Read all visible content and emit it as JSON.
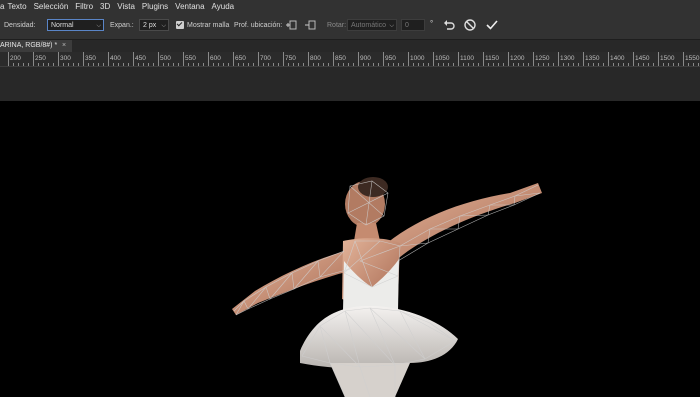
{
  "menu": {
    "items": [
      "a",
      "Texto",
      "Selección",
      "Filtro",
      "3D",
      "Vista",
      "Plugins",
      "Ventana",
      "Ayuda"
    ]
  },
  "options": {
    "density_label": "Densidad:",
    "density_value": "Normal",
    "expansion_label": "Expan.:",
    "expansion_value": "2 px",
    "show_mesh_label": "Mostrar malla",
    "pin_depth_label": "Prof. ubicación:",
    "rotate_label": "Rotar:",
    "rotate_value": "Automático",
    "angle_value": "0",
    "angle_unit": "°"
  },
  "document": {
    "tab_title": "ARINA, RGB/8#) *",
    "close_glyph": "×"
  },
  "ruler": {
    "labels": [
      "200",
      "250",
      "300",
      "350",
      "400",
      "450",
      "500",
      "550",
      "600",
      "650",
      "700",
      "750",
      "800",
      "850",
      "900",
      "950",
      "1000",
      "1050",
      "1100",
      "1150",
      "1200",
      "1250",
      "1300",
      "1350",
      "1400",
      "1450",
      "1500",
      "1550"
    ]
  },
  "icons": {
    "pin_front": "pin-front-icon",
    "pin_back": "pin-back-icon",
    "undo": "undo-icon",
    "cancel": "cancel-icon",
    "commit": "checkmark-icon"
  },
  "colors": {
    "ui_bg": "#323232",
    "canvas_bg": "#000000",
    "accent": "#5a85c7"
  }
}
